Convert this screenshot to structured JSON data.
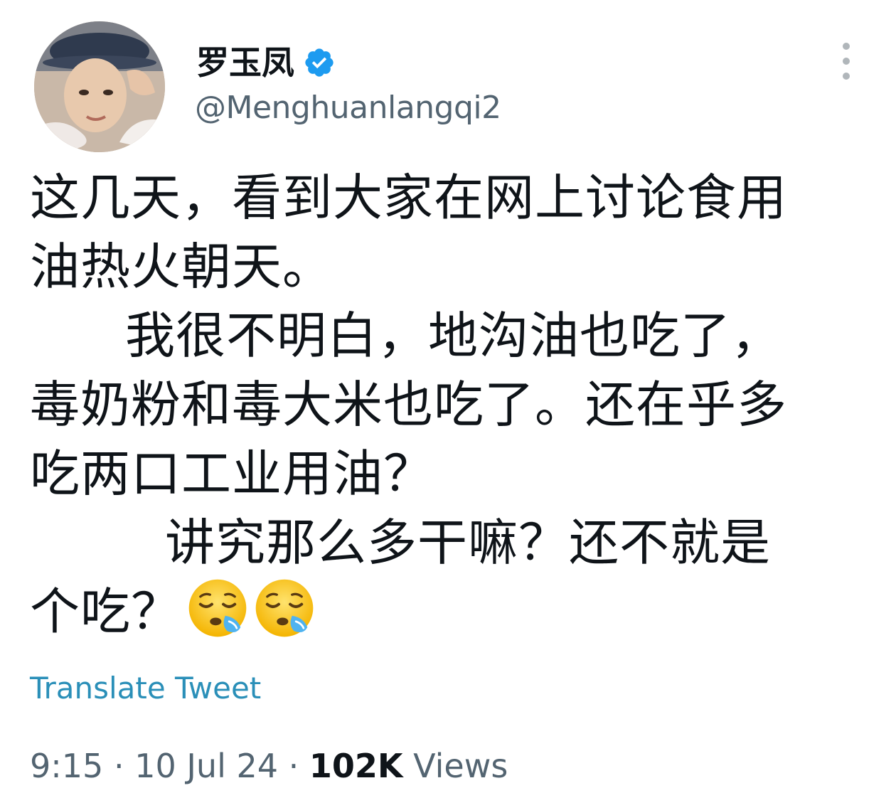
{
  "author": {
    "display_name": "罗玉凤",
    "handle": "@Menghuanlangqi2",
    "verified": true,
    "verified_color": "#1d9bf0"
  },
  "tweet": {
    "lines": [
      "这几天，看到大家在网上讨论食用",
      "油热火朝天。",
      "我很不明白，地沟油也吃了，",
      "毒奶粉和毒大米也吃了。还在乎多",
      "吃两口工业用油？",
      "讲究那么多干嘛？还不就是",
      "个吃？"
    ],
    "emojis": [
      "sleepy-face-emoji",
      "sleepy-face-emoji"
    ],
    "translate_label": "Translate Tweet"
  },
  "meta": {
    "time": "9:15",
    "separator": "·",
    "date": "10 Jul 24",
    "views_count": "102K",
    "views_label": "Views"
  },
  "colors": {
    "text": "#0f1419",
    "secondary": "#536471",
    "link": "#2a8fb8"
  }
}
